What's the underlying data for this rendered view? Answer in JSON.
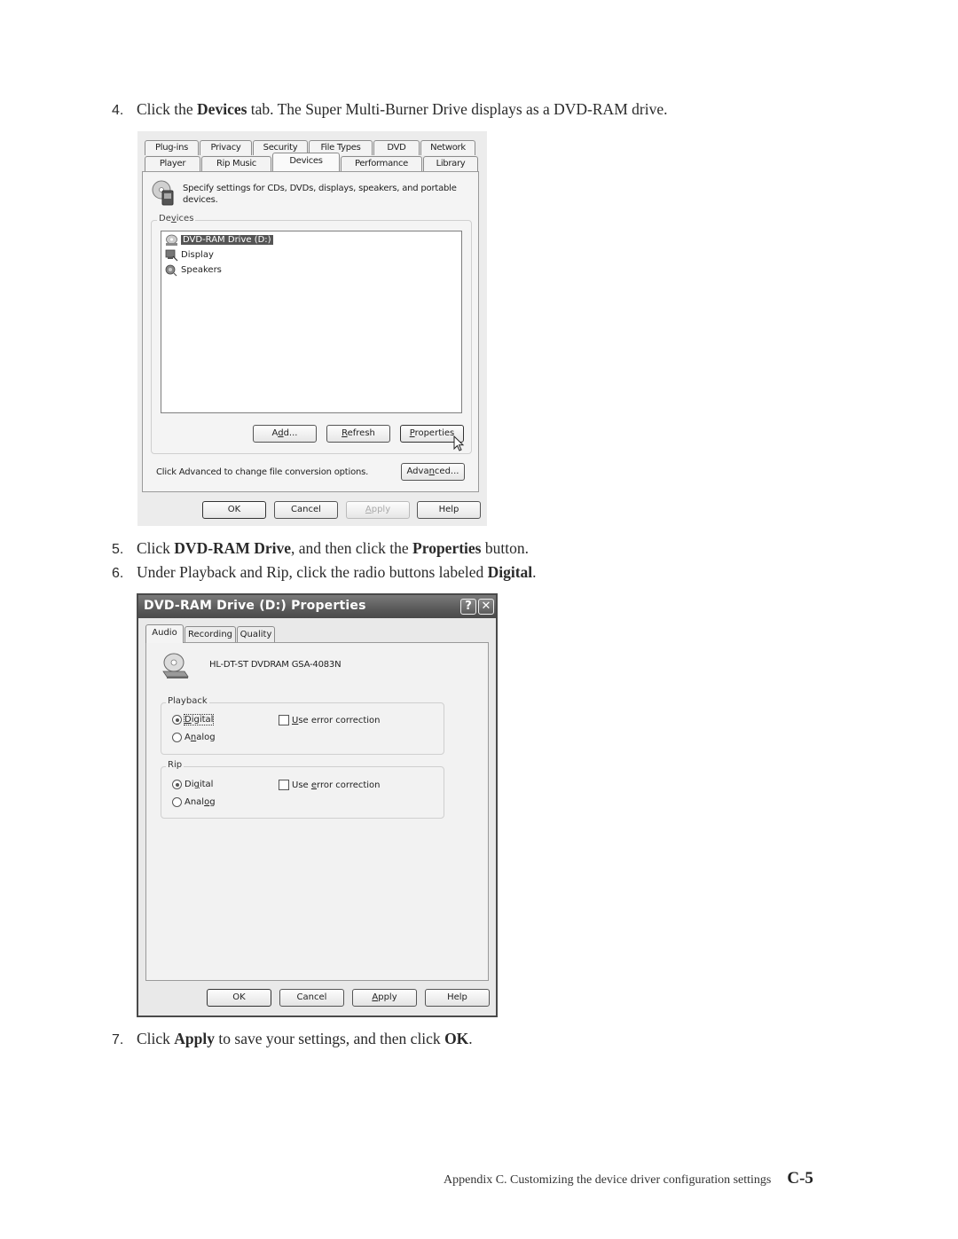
{
  "steps": [
    {
      "num": "4.",
      "pre": "Click the ",
      "bold1": "Devices",
      "post": " tab. The Super Multi-Burner Drive displays as a DVD-RAM drive."
    },
    {
      "num": "5.",
      "pre": "Click ",
      "bold1": "DVD-RAM Drive",
      "mid": ", and then click the ",
      "bold2": "Properties",
      "post": " button."
    },
    {
      "num": "6.",
      "pre": "Under Playback and Rip, click the radio buttons labeled ",
      "bold1": "Digital",
      "post": "."
    },
    {
      "num": "7.",
      "pre": "Click ",
      "bold1": "Apply",
      "mid": " to save your settings, and then click ",
      "bold2": "OK",
      "post": "."
    }
  ],
  "options_dialog": {
    "tabs_back": [
      "Plug-ins",
      "Privacy",
      "Security",
      "File Types",
      "DVD",
      "Network"
    ],
    "tabs_front": [
      "Player",
      "Rip Music",
      "Devices",
      "Performance",
      "Library"
    ],
    "active_tab": "Devices",
    "description": "Specify settings for CDs, DVDs, displays, speakers, and portable devices.",
    "group_label": "Devices",
    "devices": [
      {
        "label": "DVD-RAM Drive (D:)",
        "selected": true,
        "icon": "cd-drive-icon"
      },
      {
        "label": "Display",
        "selected": false,
        "icon": "display-icon"
      },
      {
        "label": "Speakers",
        "selected": false,
        "icon": "speaker-icon"
      }
    ],
    "buttons": {
      "add": "Add...",
      "refresh": "Refresh",
      "properties": "Properties"
    },
    "advanced_text": "Click Advanced to change file conversion options.",
    "advanced_button": "Advanced...",
    "footer_buttons": {
      "ok": "OK",
      "cancel": "Cancel",
      "apply": "Apply",
      "help": "Help"
    },
    "apply_disabled": true
  },
  "properties_dialog": {
    "title": "DVD-RAM Drive (D:) Properties",
    "help_glyph": "?",
    "close_glyph": "✕",
    "tabs": [
      "Audio",
      "Recording",
      "Quality"
    ],
    "active_tab": "Audio",
    "model": "HL-DT-ST DVDRAM GSA-4083N",
    "playback": {
      "label": "Playback",
      "digital": "Digital",
      "analog": "Analog",
      "selected": "Digital",
      "error_correction": "Use error correction",
      "error_correction_checked": false
    },
    "rip": {
      "label": "Rip",
      "digital": "Digital",
      "analog": "Analog",
      "selected": "Digital",
      "error_correction": "Use error correction",
      "error_correction_checked": false
    },
    "footer_buttons": {
      "ok": "OK",
      "cancel": "Cancel",
      "apply": "Apply",
      "help": "Help"
    }
  },
  "footer": {
    "text": "Appendix C. Customizing the device driver configuration settings",
    "page": "C-5"
  }
}
